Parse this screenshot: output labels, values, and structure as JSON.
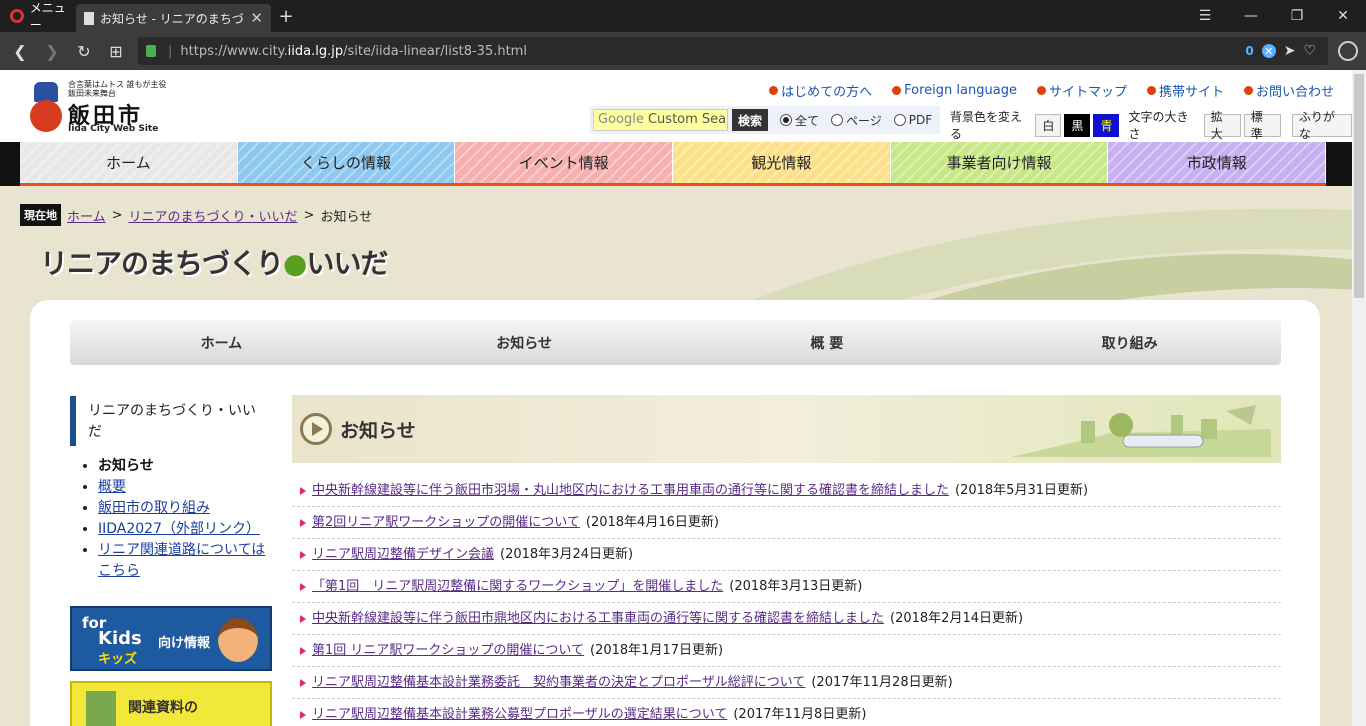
{
  "browser": {
    "menu_label": "メニュー",
    "tab_title": "お知らせ - リニアのまちづくり・いいだ",
    "new_tab": "+",
    "url_scheme": "https://www.city.",
    "url_domain": "iida.lg.jp",
    "url_path": "/site/iida-linear/list8-35.html",
    "blocked_count": "0"
  },
  "header": {
    "logo_tagline": "合言葉はムトス 誰もが主役 飯田未来舞台",
    "logo_name": "飯田市",
    "logo_en": "Iida City Web Site",
    "top_links": [
      "はじめての方へ",
      "Foreign language",
      "サイトマップ",
      "携帯サイト",
      "お問い合わせ"
    ],
    "search_google": "Google",
    "search_placeholder": "Custom Search",
    "search_button": "検索",
    "radio_options": [
      "全て",
      "ページ",
      "PDF"
    ],
    "bg_label": "背景色を変える",
    "bg_options": [
      "白",
      "黒",
      "青"
    ],
    "font_label": "文字の大きさ",
    "font_options": [
      "拡大",
      "標準"
    ],
    "furigana": "ふりがな"
  },
  "main_nav": [
    "ホーム",
    "くらしの情報",
    "イベント情報",
    "観光情報",
    "事業者向け情報",
    "市政情報"
  ],
  "main_nav_colors": [
    "#e8e8e8",
    "#8cc8f0",
    "#f6b0b0",
    "#fde08a",
    "#c8e888",
    "#c8b0f0"
  ],
  "breadcrumb": {
    "label": "現在地",
    "items": [
      "ホーム",
      "リニアのまちづくり・いいだ"
    ],
    "current": "お知らせ"
  },
  "site_title": {
    "part1": "リニアのまちづくり",
    "dot": "●",
    "part2": "いいだ"
  },
  "sub_nav": [
    "ホーム",
    "お知らせ",
    "概 要",
    "取り組み"
  ],
  "sidebar": {
    "heading": "リニアのまちづくり・いいだ",
    "items": [
      "お知らせ",
      "概要",
      "飯田市の取り組み",
      "IIDA2027（外部リンク）",
      "リニア関連道路についてはこちら"
    ],
    "kids_for": "for",
    "kids_kids": "Kids",
    "kids_kana": "キッズ",
    "kids_label": "向け情報",
    "kanren_label": "関連資料の"
  },
  "content": {
    "heading": "お知らせ",
    "news": [
      {
        "title": "中央新幹線建設等に伴う飯田市羽場・丸山地区内における工事用車両の通行等に関する確認書を締結しました",
        "date": "(2018年5月31日更新)"
      },
      {
        "title": "第2回リニア駅ワークショップの開催について",
        "date": "(2018年4月16日更新)"
      },
      {
        "title": "リニア駅周辺整備デザイン会議",
        "date": "(2018年3月24日更新)"
      },
      {
        "title": "「第1回　リニア駅周辺整備に関するワークショップ」を開催しました",
        "date": "(2018年3月13日更新)"
      },
      {
        "title": "中央新幹線建設等に伴う飯田市鼎地区内における工事車両の通行等に関する確認書を締結しました",
        "date": "(2018年2月14日更新)"
      },
      {
        "title": "第1回 リニア駅ワークショップの開催について",
        "date": "(2018年1月17日更新)"
      },
      {
        "title": "リニア駅周辺整備基本設計業務委託　契約事業者の決定とプロポーザル総評について",
        "date": "(2017年11月28日更新)"
      },
      {
        "title": "リニア駅周辺整備基本設計業務公募型プロポーザルの選定結果について",
        "date": "(2017年11月8日更新)"
      }
    ]
  }
}
